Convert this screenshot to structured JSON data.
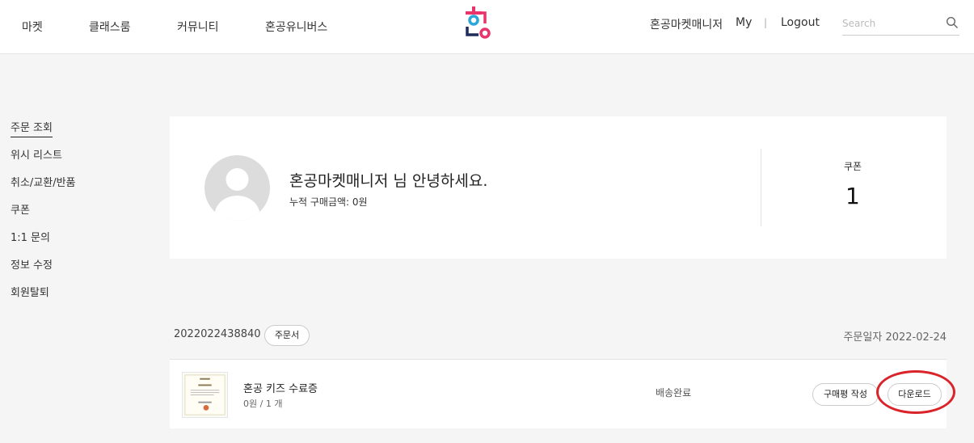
{
  "header": {
    "nav": [
      "마켓",
      "클래스룸",
      "커뮤니티",
      "혼공유니버스"
    ],
    "user_name": "혼공마켓매니저",
    "my_label": "My",
    "separator": "|",
    "logout_label": "Logout",
    "search": {
      "placeholder": "Search"
    },
    "logo_colors": [
      "#2ba6d9",
      "#e8336b",
      "#1f2b5b"
    ]
  },
  "sidebar": {
    "items": [
      {
        "label": "주문 조회",
        "active": true
      },
      {
        "label": "위시 리스트"
      },
      {
        "label": "취소/교환/반품"
      },
      {
        "label": "쿠폰"
      },
      {
        "label": "1:1 문의"
      },
      {
        "label": "정보 수정"
      },
      {
        "label": "회원탈퇴"
      }
    ]
  },
  "profile": {
    "greeting": "혼공마켓매니저 님 안녕하세요.",
    "total_purchase": "누적 구매금액: 0원",
    "coupon_label": "쿠폰",
    "coupon_count": "1"
  },
  "order": {
    "number": "2022022438840",
    "sheet_button": "주문서",
    "date": "주문일자 2022-02-24",
    "items": [
      {
        "name": "혼공 키즈 수료증",
        "meta": "0원 / 1 개",
        "status": "배송완료",
        "review_button": "구매평 작성",
        "download_button": "다운로드"
      }
    ]
  },
  "colors": {
    "highlight": "#d9242a",
    "background": "#f5f5f5"
  }
}
